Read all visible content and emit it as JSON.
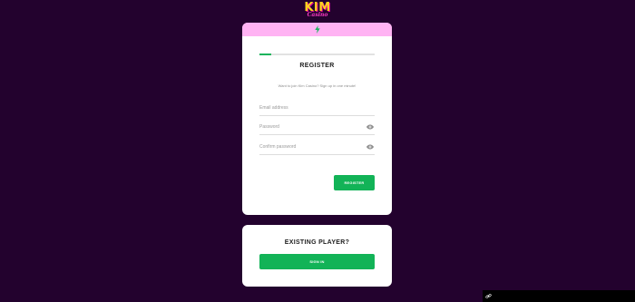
{
  "brand": {
    "logo_main": "KIM",
    "logo_sub": "Casino"
  },
  "register": {
    "progress": 0.1,
    "title": "REGISTER",
    "subtitle": "Want to join Kim Casino? Sign up in one minute!",
    "email": {
      "placeholder": "Email address",
      "value": ""
    },
    "password": {
      "placeholder": "Password",
      "value": ""
    },
    "confirm": {
      "placeholder": "Confirm password",
      "value": ""
    },
    "button_label": "REGISTER"
  },
  "existing": {
    "title": "EXISTING PLAYER?",
    "button_label": "SIGN IN"
  },
  "colors": {
    "background": "#23022e",
    "header_pink": "#ffb3f3",
    "accent_green": "#12b357",
    "logo_yellow": "#ffd21f",
    "logo_pink": "#ff3cc7"
  },
  "icons": [
    "lightning-bolt-icon",
    "eye-icon",
    "link-icon"
  ]
}
